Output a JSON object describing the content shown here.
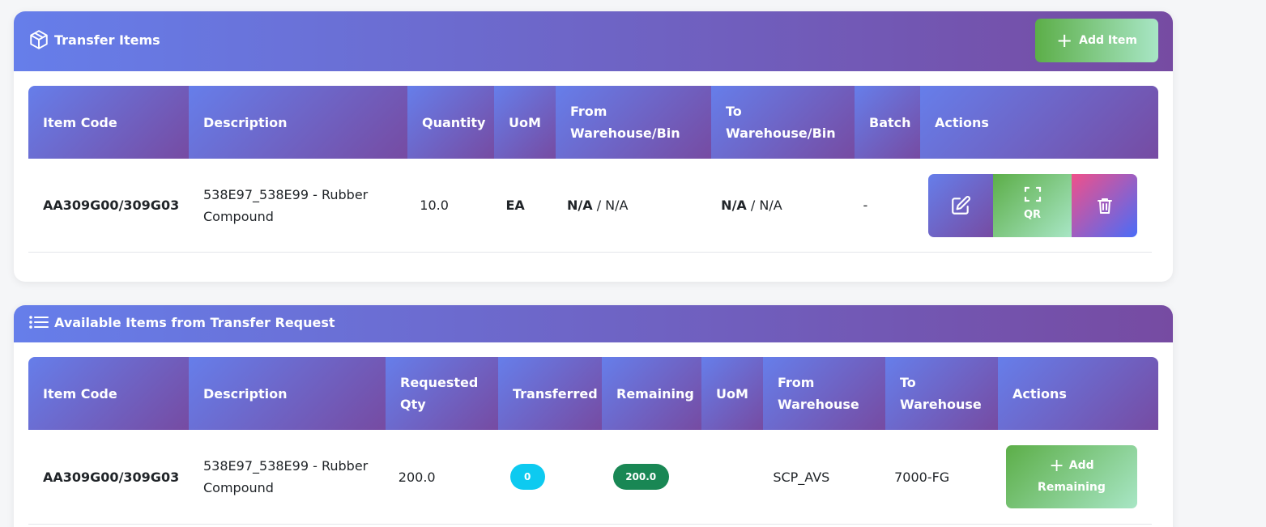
{
  "transfer_items": {
    "title": "Transfer Items",
    "add_button": "Add Item",
    "columns": [
      "Item Code",
      "Description",
      "Quantity",
      "UoM",
      "From Warehouse/Bin",
      "To Warehouse/Bin",
      "Batch",
      "Actions"
    ],
    "header_lines": {
      "from_l1": "From",
      "from_l2": "Warehouse/Bin",
      "to_l1": "To",
      "to_l2": "Warehouse/Bin"
    },
    "rows": [
      {
        "item_code": "AA309G00/309G03",
        "description_l1": "538E97_538E99 - Rubber",
        "description_l2": "Compound",
        "quantity": "10.0",
        "uom": "EA",
        "from_warehouse": "N/A",
        "from_bin": " / N/A",
        "to_warehouse": "N/A",
        "to_bin": " / N/A",
        "batch": "-",
        "qr_label": "QR"
      }
    ]
  },
  "available_items": {
    "title": "Available Items from Transfer Request",
    "header_lines": {
      "item_code": "Item Code",
      "description": "Description",
      "req_l1": "Requested",
      "req_l2": "Qty",
      "transferred": "Transferred",
      "remaining": "Remaining",
      "uom": "UoM",
      "from_l1": "From",
      "from_l2": "Warehouse",
      "to_l1": "To",
      "to_l2": "Warehouse",
      "actions": "Actions"
    },
    "rows": [
      {
        "item_code": "AA309G00/309G03",
        "description_l1": "538E97_538E99 - Rubber",
        "description_l2": "Compound",
        "requested_qty": "200.0",
        "transferred": "0",
        "remaining": "200.0",
        "uom": "",
        "from_warehouse": "SCP_AVS",
        "to_warehouse": "7000-FG",
        "action_l1": "Add",
        "action_l2": "Remaining"
      }
    ]
  }
}
